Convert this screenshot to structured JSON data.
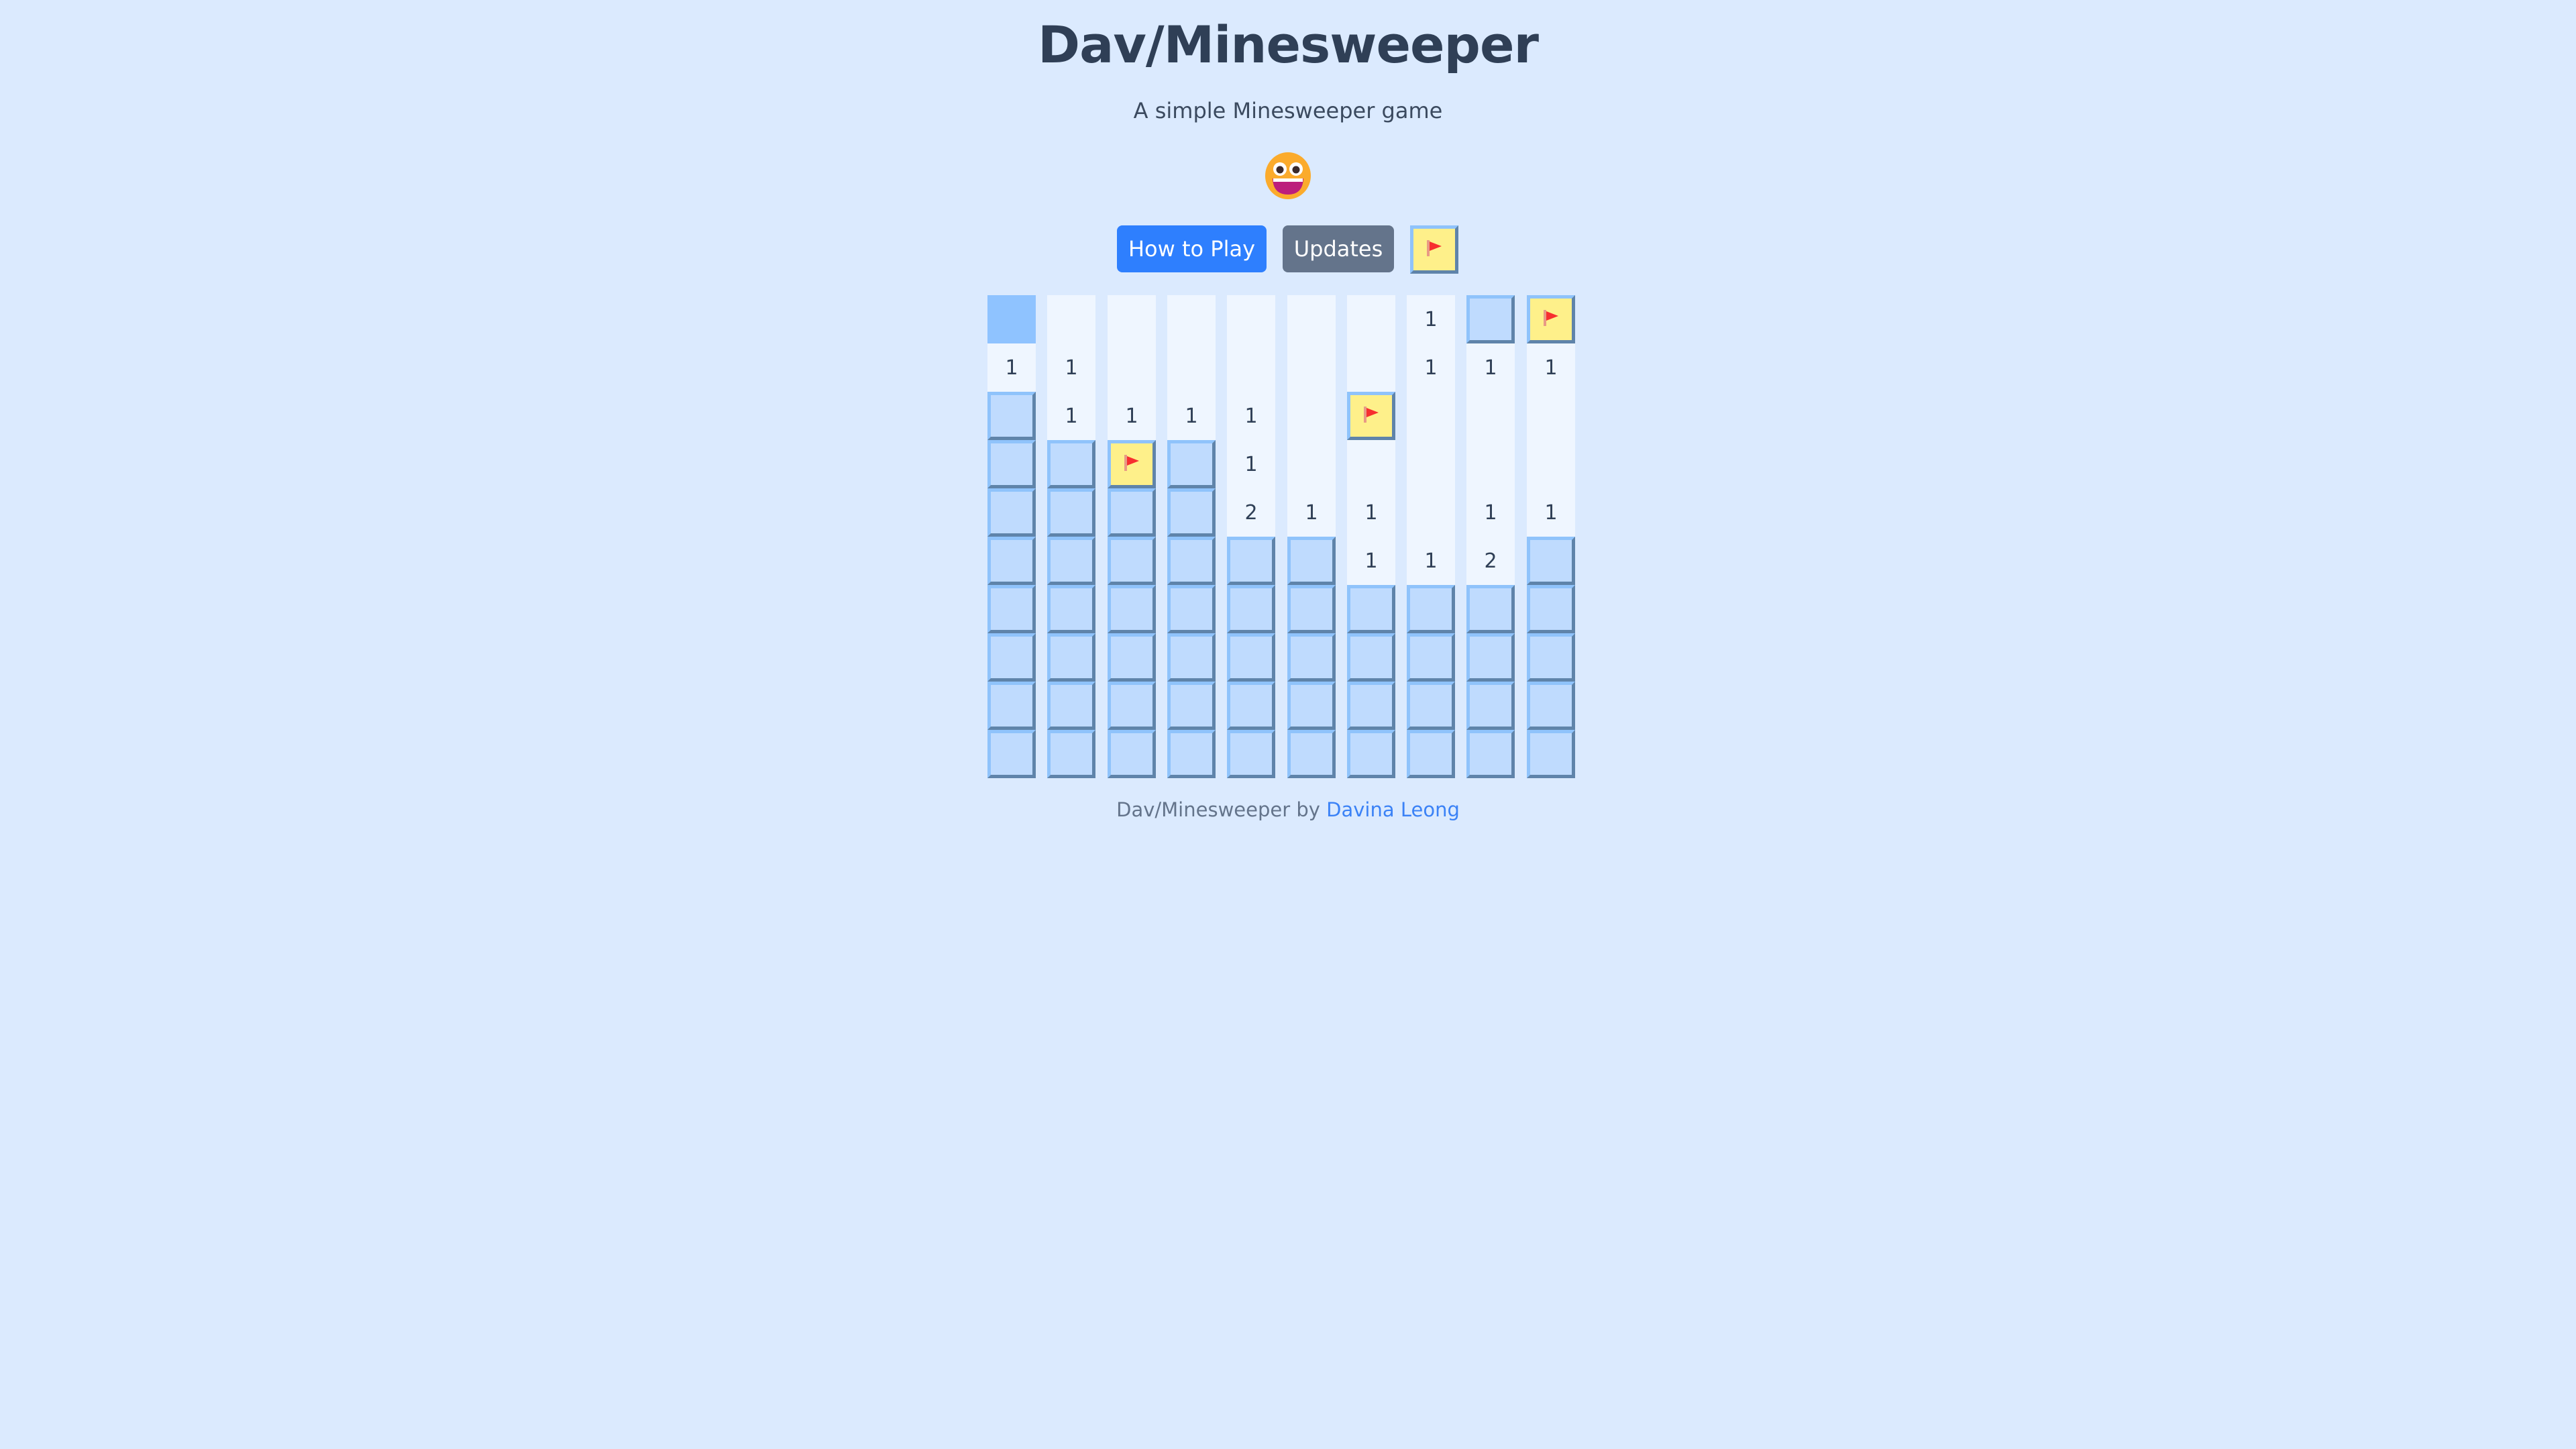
{
  "header": {
    "title": "Dav/Minesweeper",
    "subtitle": "A simple Minesweeper game",
    "face_icon": "grinning-face-emoji"
  },
  "toolbar": {
    "how_to_play_label": "How to Play",
    "updates_label": "Updates",
    "flag_mode_icon": "flag-icon",
    "how_to_play_color": "#2e7ffe",
    "updates_color": "#64748b"
  },
  "board": {
    "columns": 10,
    "rows": 10,
    "legend": {
      "H": "hidden",
      "F": "flagged",
      "A": "active",
      "R": "revealed-empty"
    },
    "cells": [
      [
        "A",
        "R",
        "R",
        "R",
        "R",
        "R",
        "R",
        "1",
        "H",
        "F"
      ],
      [
        "1",
        "1",
        "R",
        "R",
        "R",
        "R",
        "R",
        "1",
        "1",
        "1"
      ],
      [
        "H",
        "1",
        "1",
        "1",
        "1",
        "R",
        "F",
        "R",
        "R",
        "R"
      ],
      [
        "H",
        "H",
        "F",
        "H",
        "1",
        "R",
        "R",
        "R",
        "R",
        "R"
      ],
      [
        "H",
        "H",
        "H",
        "H",
        "2",
        "1",
        "1",
        "R",
        "1",
        "1"
      ],
      [
        "H",
        "H",
        "H",
        "H",
        "H",
        "H",
        "1",
        "1",
        "2",
        "H"
      ],
      [
        "H",
        "H",
        "H",
        "H",
        "H",
        "H",
        "H",
        "H",
        "H",
        "H"
      ],
      [
        "H",
        "H",
        "H",
        "H",
        "H",
        "H",
        "H",
        "H",
        "H",
        "H"
      ],
      [
        "H",
        "H",
        "H",
        "H",
        "H",
        "H",
        "H",
        "H",
        "H",
        "H"
      ],
      [
        "H",
        "H",
        "H",
        "H",
        "H",
        "H",
        "H",
        "H",
        "H",
        "H"
      ]
    ],
    "colors": {
      "hidden": "#bfdbfe",
      "revealed": "#eff6ff",
      "flagged": "#fef08a",
      "active": "#8fc3ff",
      "flag": "#f72f2f"
    }
  },
  "footer": {
    "prefix": "Dav/Minesweeper by ",
    "author_link": "Davina Leong"
  }
}
